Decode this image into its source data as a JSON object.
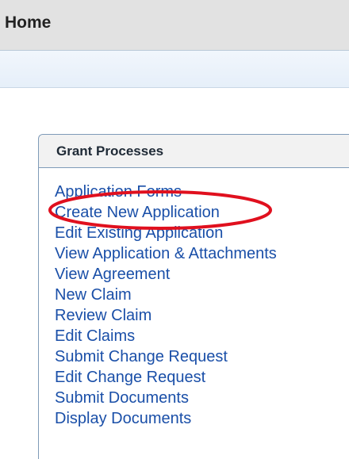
{
  "header": {
    "title": "Home"
  },
  "panel": {
    "title": "Grant Processes",
    "items": [
      {
        "label": "Application Forms"
      },
      {
        "label": "Create New Application"
      },
      {
        "label": "Edit Existing Application"
      },
      {
        "label": "View Application & Attachments"
      },
      {
        "label": "View Agreement"
      },
      {
        "label": "New Claim"
      },
      {
        "label": "Review Claim"
      },
      {
        "label": "Edit Claims"
      },
      {
        "label": "Submit Change Request"
      },
      {
        "label": "Edit Change Request"
      },
      {
        "label": "Submit Documents"
      },
      {
        "label": "Display Documents"
      }
    ]
  },
  "annotation": {
    "highlight_color": "#e0101e",
    "highlighted_item": "Create New Application"
  },
  "colors": {
    "link": "#1a4fa8",
    "panel_border": "#7f9bb8",
    "header_background": "#e2e2e2"
  }
}
